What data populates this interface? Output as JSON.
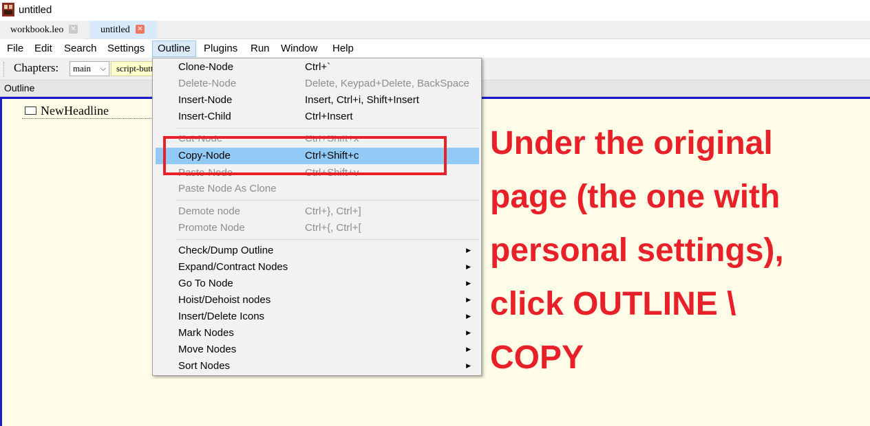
{
  "window": {
    "title": "untitled"
  },
  "tabs": [
    {
      "label": "workbook.leo",
      "close": "✕"
    },
    {
      "label": "untitled",
      "close": "✕"
    }
  ],
  "menubar": [
    "File",
    "Edit",
    "Search",
    "Settings",
    "Outline",
    "Plugins",
    "Run",
    "Window",
    "Help"
  ],
  "menubar_active": "Outline",
  "toolbar": {
    "chapters_label": "Chapters:",
    "chapter_value": "main",
    "script_button": "script-button"
  },
  "outline_pane": {
    "header": "Outline",
    "nodes": [
      {
        "headline": "NewHeadline"
      }
    ]
  },
  "outline_menu": [
    {
      "label": "Clone-Node",
      "shortcut": "Ctrl+`",
      "enabled": true
    },
    {
      "label": "Delete-Node",
      "shortcut": "Delete, Keypad+Delete, BackSpace",
      "enabled": false
    },
    {
      "label": "Insert-Node",
      "shortcut": "Insert, Ctrl+i, Shift+Insert",
      "enabled": true
    },
    {
      "label": "Insert-Child",
      "shortcut": "Ctrl+Insert",
      "enabled": true
    },
    {
      "label": "Cut-Node",
      "shortcut": "Ctrl+Shift+x",
      "enabled": false
    },
    {
      "label": "Copy-Node",
      "shortcut": "Ctrl+Shift+c",
      "enabled": true,
      "highlighted": true
    },
    {
      "label": "Paste-Node",
      "shortcut": "Ctrl+Shift+v",
      "enabled": false
    },
    {
      "label": "Paste Node As Clone",
      "shortcut": "",
      "enabled": false
    },
    {
      "label": "Demote node",
      "shortcut": "Ctrl+}, Ctrl+]",
      "enabled": false
    },
    {
      "label": "Promote Node",
      "shortcut": "Ctrl+{, Ctrl+[",
      "enabled": false
    },
    {
      "label": "Check/Dump Outline",
      "submenu": true
    },
    {
      "label": "Expand/Contract Nodes",
      "submenu": true
    },
    {
      "label": "Go To Node",
      "submenu": true
    },
    {
      "label": "Hoist/Dehoist nodes",
      "submenu": true
    },
    {
      "label": "Insert/Delete Icons",
      "submenu": true
    },
    {
      "label": "Mark Nodes",
      "submenu": true
    },
    {
      "label": "Move Nodes",
      "submenu": true
    },
    {
      "label": "Sort Nodes",
      "submenu": true
    }
  ],
  "annotation": {
    "lines": [
      "Under the original",
      "page (the one with",
      "personal settings),",
      "click OUTLINE \\",
      "COPY"
    ]
  },
  "colors": {
    "annotation": "#e8202a",
    "highlight_rect": "#e8202a",
    "menu_hover": "#91c9f7",
    "outline_border": "#1919d0",
    "outline_background": "#fffde7"
  },
  "icons": {
    "app": "leo-app-icon",
    "tab_close": "close-icon",
    "submenu_arrow": "chevron-right-icon",
    "select_arrow": "chevron-down-icon",
    "node": "node-box-icon"
  }
}
